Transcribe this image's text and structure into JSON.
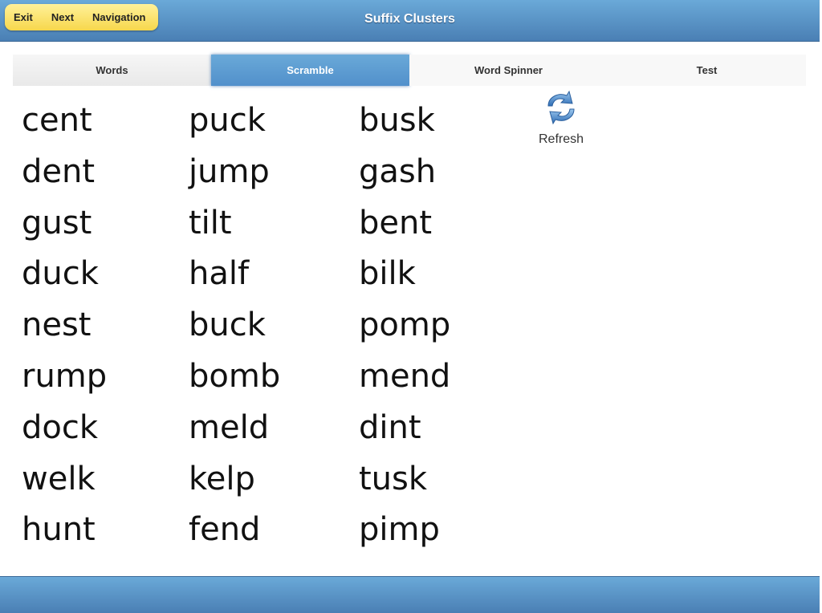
{
  "header": {
    "title": "Suffix Clusters",
    "nav": {
      "exit": "Exit",
      "next": "Next",
      "navigation": "Navigation"
    }
  },
  "tabs": [
    {
      "label": "Words",
      "active": false
    },
    {
      "label": "Scramble",
      "active": true
    },
    {
      "label": "Word Spinner",
      "active": false
    },
    {
      "label": "Test",
      "active": false
    }
  ],
  "refresh": {
    "label": "Refresh",
    "icon": "refresh-icon"
  },
  "columns": [
    [
      "cent",
      "dent",
      "gust",
      "duck",
      "nest",
      "rump",
      "dock",
      "welk",
      "hunt"
    ],
    [
      "puck",
      "jump",
      "tilt",
      "half",
      "buck",
      "bomb",
      "meld",
      "kelp",
      "fend"
    ],
    [
      "busk",
      "gash",
      "bent",
      "bilk",
      "pomp",
      "mend",
      "dint",
      "tusk",
      "pimp"
    ]
  ],
  "colors": {
    "header": "#5b96cc",
    "nav_pill": "#f9e27a",
    "active_tab": "#5b9bd5"
  }
}
